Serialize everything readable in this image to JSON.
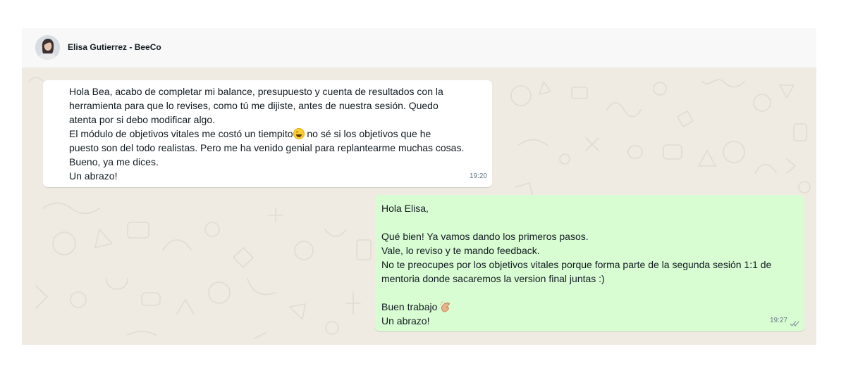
{
  "header": {
    "contact_name": "Elisa Gutierrez - BeeCo",
    "avatar_icon": "user-avatar-icon"
  },
  "messages": [
    {
      "direction": "incoming",
      "lines": [
        "Hola Bea, acabo de completar mi balance, presupuesto y cuenta de resultados con la",
        "herramienta para que lo revises, como tú me dijiste, antes de nuestra sesión. Quedo",
        "atenta por si debo modificar algo.",
        "El módulo de objetivos vitales me costó un tiempito",
        " no sé si los objetivos que he",
        "puesto son del todo realistas. Pero me ha venido genial para replantearme muchas cosas.",
        "Bueno, ya me dices.",
        "Un abrazo!"
      ],
      "emoji": "grinning-sweat-face-emoji",
      "time": "19:20"
    },
    {
      "direction": "outgoing",
      "lines": [
        "Hola Elisa,",
        "",
        "Qué bien! Ya vamos dando los primeros pasos.",
        "Vale, lo reviso y te mando feedback.",
        "No te preocupes por los objetivos vitales porque forma parte de la segunda sesión 1:1 de",
        "mentoria donde sacaremos la version final juntas :)",
        "",
        "Buen trabajo ",
        "Un abrazo!"
      ],
      "emoji": "clapping-hands-emoji",
      "time": "19:27",
      "status_icon": "double-check-icon"
    }
  ],
  "colors": {
    "chat_background": "#efeae2",
    "incoming_bubble": "#ffffff",
    "outgoing_bubble": "#d9fdd3",
    "header_background": "#f8f8f8",
    "timestamp": "#667781"
  }
}
